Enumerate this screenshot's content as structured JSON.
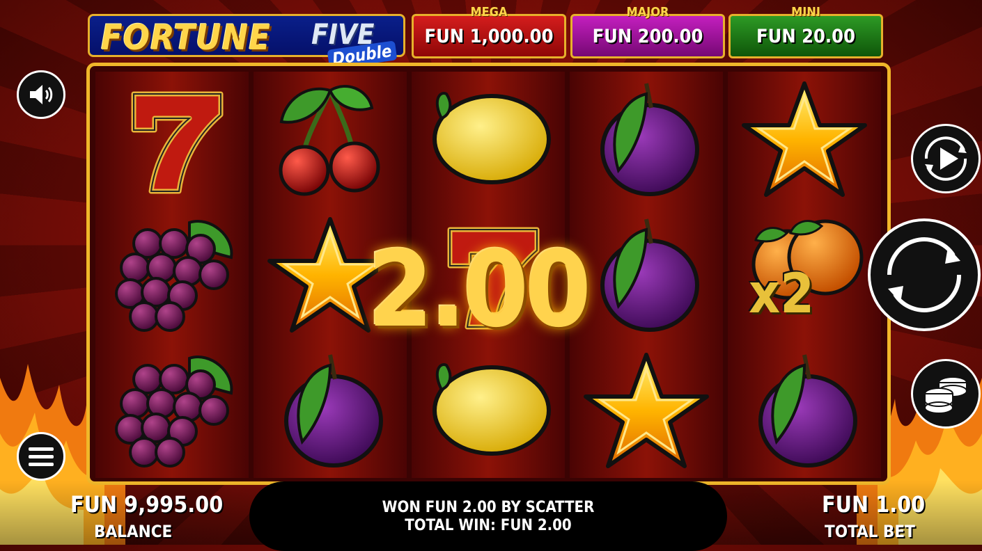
{
  "logo": {
    "word1": "FORTUNE",
    "word2": "FIVE",
    "word3": "Double"
  },
  "jackpots": [
    {
      "label": "MEGA",
      "value": "FUN 1,000.00",
      "color": "#c0141a"
    },
    {
      "label": "MAJOR",
      "value": "FUN 200.00",
      "color": "#a01898"
    },
    {
      "label": "MINI",
      "value": "FUN 20.00",
      "color": "#1f7a18"
    }
  ],
  "reels": [
    [
      "seven-icon",
      "grapes-icon",
      "grapes-icon"
    ],
    [
      "cherry-icon",
      "star-scatter-icon",
      "plum-icon"
    ],
    [
      "lemon-icon",
      "seven-icon",
      "lemon-icon"
    ],
    [
      "plum-icon",
      "plum-icon",
      "star-scatter-icon"
    ],
    [
      "star-scatter-icon",
      "orange-x2-icon",
      "plum-icon"
    ]
  ],
  "win_overlay": "2.00",
  "multiplier_label": "x2",
  "message": {
    "line1": "WON FUN 2.00 BY SCATTER",
    "line2": "TOTAL WIN: FUN 2.00"
  },
  "balance": {
    "value": "FUN 9,995.00",
    "label": "BALANCE"
  },
  "total_bet": {
    "value": "FUN 1.00",
    "label": "TOTAL BET"
  },
  "controls": [
    "sound-icon",
    "autoplay-icon",
    "spin-icon",
    "bet-coins-icon",
    "menu-icon"
  ]
}
